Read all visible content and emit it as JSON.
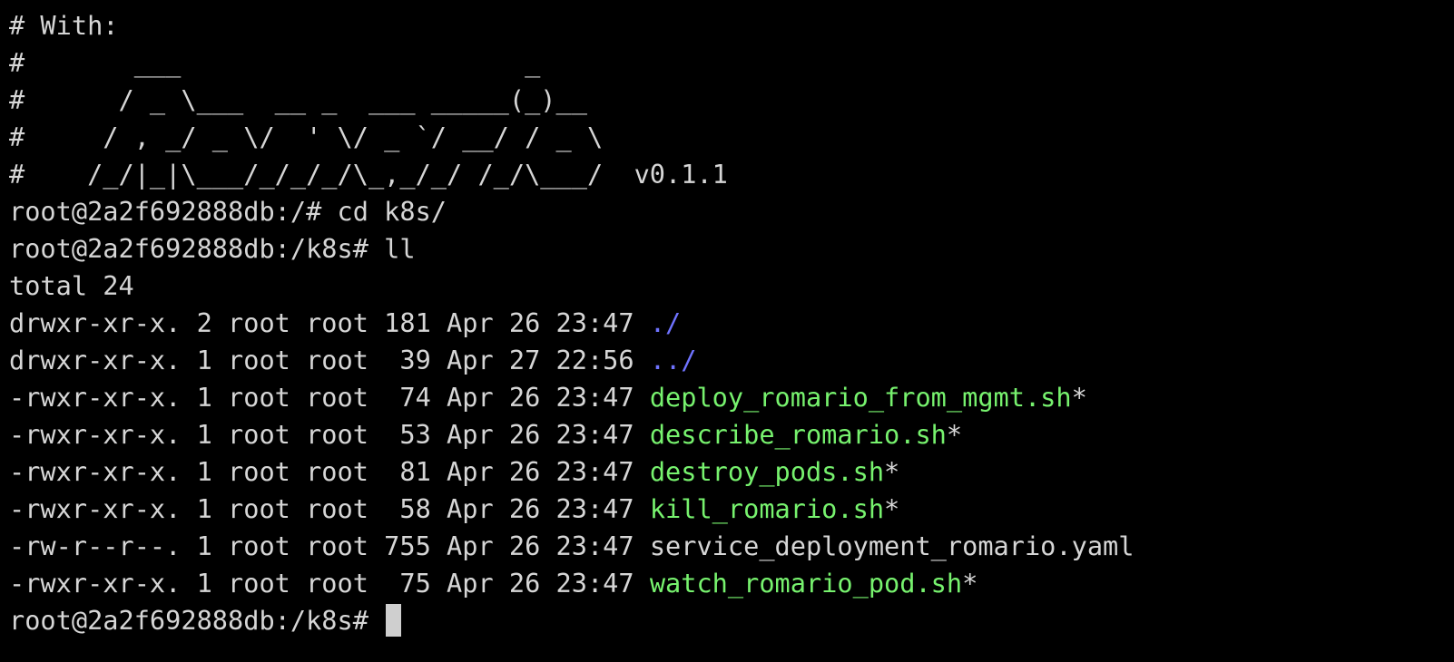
{
  "colors": {
    "background": "#000000",
    "text": "#d6d6d6",
    "directory": "#6f73ff",
    "executable": "#77f26e",
    "cursor": "#cfcfcf"
  },
  "banner": [
    "# With:",
    "#       ___                      _",
    "#      / _ \\___  __ _  ___ _____(_)__",
    "#     / , _/ _ \\/  ' \\/ _ `/ __/ / _ \\",
    "#    /_/|_|\\___/_/_/_/\\_,_/_/ /_/\\___/  v0.1.1"
  ],
  "commands": [
    "root@2a2f692888db:/# cd k8s/",
    "root@2a2f692888db:/k8s# ll"
  ],
  "total": "total 24",
  "listing": [
    {
      "meta": "drwxr-xr-x. 2 root root 181 Apr 26 23:47 ",
      "name": "./",
      "kind": "dir",
      "suffix": ""
    },
    {
      "meta": "drwxr-xr-x. 1 root root  39 Apr 27 22:56 ",
      "name": "../",
      "kind": "dir",
      "suffix": ""
    },
    {
      "meta": "-rwxr-xr-x. 1 root root  74 Apr 26 23:47 ",
      "name": "deploy_romario_from_mgmt.sh",
      "kind": "exe",
      "suffix": "*"
    },
    {
      "meta": "-rwxr-xr-x. 1 root root  53 Apr 26 23:47 ",
      "name": "describe_romario.sh",
      "kind": "exe",
      "suffix": "*"
    },
    {
      "meta": "-rwxr-xr-x. 1 root root  81 Apr 26 23:47 ",
      "name": "destroy_pods.sh",
      "kind": "exe",
      "suffix": "*"
    },
    {
      "meta": "-rwxr-xr-x. 1 root root  58 Apr 26 23:47 ",
      "name": "kill_romario.sh",
      "kind": "exe",
      "suffix": "*"
    },
    {
      "meta": "-rw-r--r--. 1 root root 755 Apr 26 23:47 ",
      "name": "service_deployment_romario.yaml",
      "kind": "plain",
      "suffix": ""
    },
    {
      "meta": "-rwxr-xr-x. 1 root root  75 Apr 26 23:47 ",
      "name": "watch_romario_pod.sh",
      "kind": "exe",
      "suffix": "*"
    }
  ],
  "prompt": "root@2a2f692888db:/k8s# "
}
